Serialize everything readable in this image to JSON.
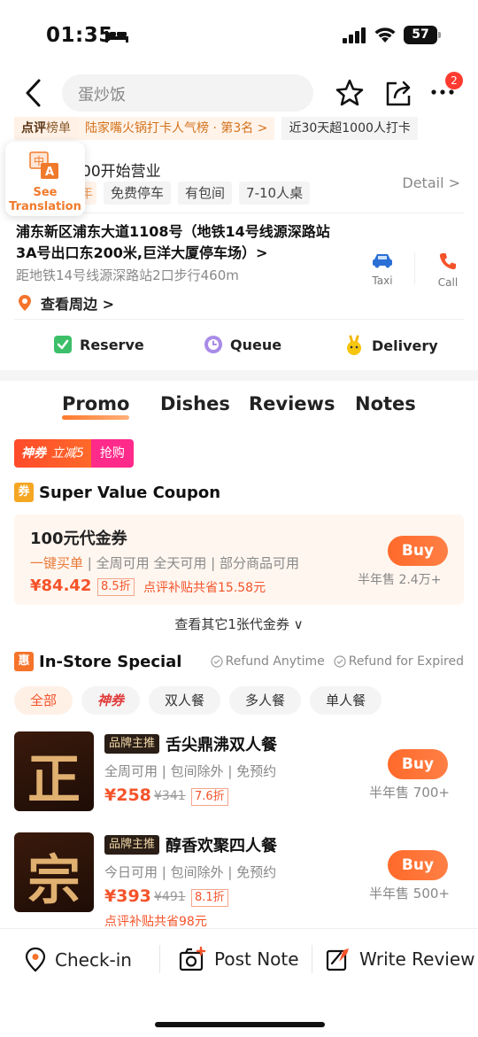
{
  "status_bar": {
    "time": "01:35",
    "battery": "57"
  },
  "nav": {
    "search_placeholder": "蛋炒饭",
    "more_badge": "2"
  },
  "rank": {
    "label_prefix": "点评",
    "label_suffix": "榜单",
    "desc": "陆家嘴火锅打卡人气榜 · 第3名 >",
    "checkin": "近30天超1000人打卡"
  },
  "translation": {
    "label": "See Translation"
  },
  "info": {
    "hours": "00开始营业",
    "features": [
      "年",
      "免费停车",
      "有包间",
      "7-10人桌"
    ],
    "detail_link": "Detail >",
    "address": "浦东新区浦东大道1108号（地铁14号线源深路站3A号出口东200米,巨洋大厦停车场）>",
    "walk": "距地铁14号线源深路站2口步行460m",
    "nearby": "查看周边 >",
    "taxi_label": "Taxi",
    "call_label": "Call"
  },
  "services": {
    "reserve": "Reserve",
    "queue": "Queue",
    "delivery": "Delivery"
  },
  "tabs": {
    "promo": "Promo",
    "dishes": "Dishes",
    "reviews": "Reviews",
    "notes": "Notes"
  },
  "deal_badge": {
    "brand": "神券",
    "discount": "立减5",
    "action": "抢购"
  },
  "coupon_section": {
    "icon": "券",
    "title": "Super Value Coupon",
    "card": {
      "title": "100元代金券",
      "term_highlight": "一键买单",
      "terms": " | 全周可用 全天可用 | 部分商品可用",
      "price": "¥84.42",
      "discount": "8.5折",
      "subsidy": "点评补贴共省15.58元",
      "buy": "Buy",
      "sold": "半年售 2.4万+"
    },
    "more": "查看其它1张代金券 ∨"
  },
  "special_section": {
    "icon": "惠",
    "title": "In-Store Special",
    "refund_anytime": "Refund Anytime",
    "refund_expired": "Refund for Expired",
    "filters": [
      "全部",
      "神券",
      "双人餐",
      "多人餐",
      "单人餐"
    ],
    "items": [
      {
        "image_char": "正",
        "brand_tag": "品牌主推",
        "title": "舌尖鼎沸双人餐",
        "terms": "全周可用 | 包间除外 | 免预约",
        "price": "¥258",
        "orig": "¥341",
        "discount": "7.6折",
        "subsidy": "",
        "buy": "Buy",
        "sold": "半年售 700+"
      },
      {
        "image_char": "宗",
        "brand_tag": "品牌主推",
        "title": "醇香欢聚四人餐",
        "terms": "今日可用 | 包间除外 | 免预约",
        "price": "¥393",
        "orig": "¥491",
        "discount": "8.1折",
        "subsidy": "点评补贴共省98元",
        "buy": "Buy",
        "sold": "半年售 500+"
      }
    ]
  },
  "bottom_bar": {
    "checkin": "Check-in",
    "post_note": "Post Note",
    "write_review": "Write Review"
  },
  "colors": {
    "accent": "#f5532a",
    "orange": "#ff6a2a"
  }
}
